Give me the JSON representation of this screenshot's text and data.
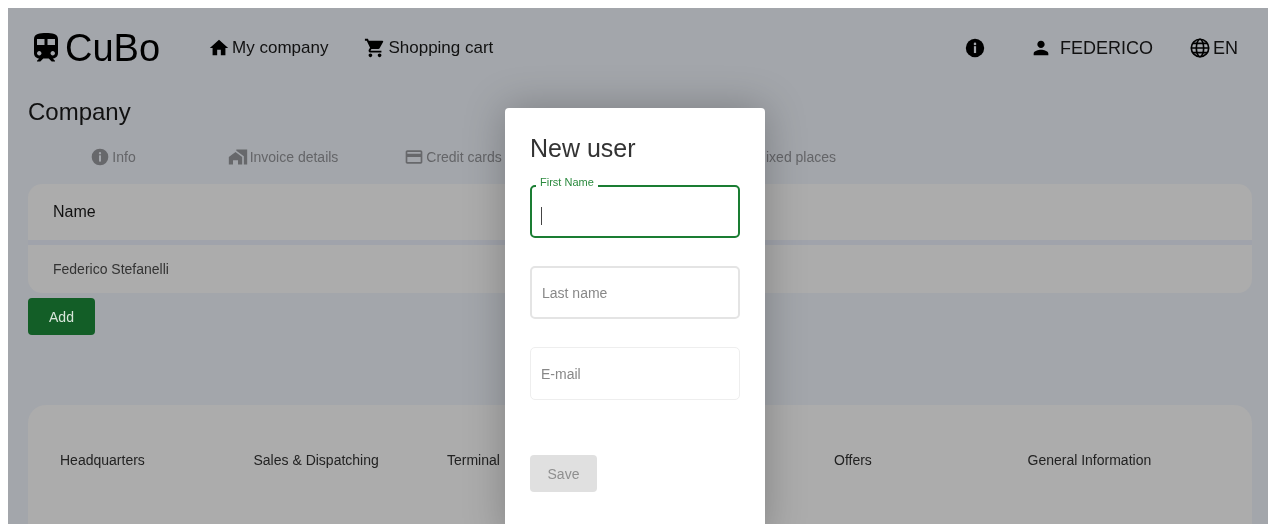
{
  "header": {
    "logo": "CuBo",
    "nav": [
      {
        "label": "My company",
        "kind": "home"
      },
      {
        "label": "Shopping cart",
        "kind": "cart"
      }
    ],
    "user": "FEDERICO",
    "language": "EN"
  },
  "page": {
    "title": "Company",
    "tabs": [
      {
        "label": "Info",
        "kind": "info",
        "selected": false
      },
      {
        "label": "Invoice details",
        "kind": "building",
        "selected": false
      },
      {
        "label": "Credit cards",
        "kind": "card",
        "selected": false
      },
      {
        "label": "ixed places",
        "kind": "plain",
        "selected": false
      }
    ],
    "table": {
      "columns": [
        "Name"
      ],
      "rows": [
        [
          "Federico Stefanelli"
        ]
      ]
    },
    "add_button": "Add",
    "footer": [
      "Headquarters",
      "Sales & Dispatching",
      "Terminal",
      "Offers",
      "General Information"
    ]
  },
  "dialog": {
    "title": "New user",
    "fields": [
      {
        "label": "First Name",
        "focused": true
      },
      {
        "placeholder": "Last name",
        "focused": false
      },
      {
        "placeholder": "E-mail",
        "focused": false
      }
    ],
    "save_button": {
      "label": "Save",
      "disabled": true
    }
  }
}
